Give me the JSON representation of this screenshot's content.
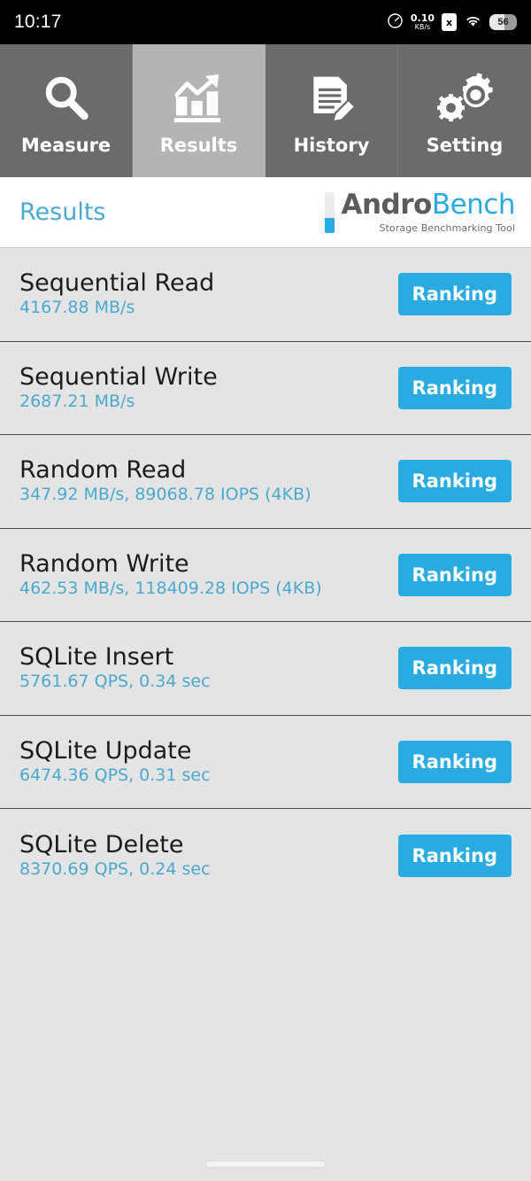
{
  "statusbar": {
    "time": "10:17",
    "network_speed_value": "0.10",
    "network_speed_unit": "KB/s",
    "speed_icon": "speedometer-icon",
    "sim_icon_label": "x",
    "wifi_icon": "wifi-icon",
    "battery_level": "56"
  },
  "tabs": [
    {
      "label": "Measure",
      "icon": "magnifier-icon",
      "active": false
    },
    {
      "label": "Results",
      "icon": "bar-chart-arrow-icon",
      "active": true
    },
    {
      "label": "History",
      "icon": "document-pencil-icon",
      "active": false
    },
    {
      "label": "Setting",
      "icon": "gears-icon",
      "active": false
    }
  ],
  "header": {
    "title": "Results",
    "logo_primary": "Andro",
    "logo_secondary": "Bench",
    "logo_tagline": "Storage Benchmarking Tool",
    "logo_bar_icon": "storage-level-bar-icon"
  },
  "results": [
    {
      "title": "Sequential Read",
      "value": "4167.88 MB/s",
      "button": "Ranking"
    },
    {
      "title": "Sequential Write",
      "value": "2687.21 MB/s",
      "button": "Ranking"
    },
    {
      "title": "Random Read",
      "value": "347.92 MB/s, 89068.78 IOPS (4KB)",
      "button": "Ranking"
    },
    {
      "title": "Random Write",
      "value": "462.53 MB/s, 118409.28 IOPS (4KB)",
      "button": "Ranking"
    },
    {
      "title": "SQLite Insert",
      "value": "5761.67 QPS, 0.34 sec",
      "button": "Ranking"
    },
    {
      "title": "SQLite Update",
      "value": "6474.36 QPS, 0.31 sec",
      "button": "Ranking"
    },
    {
      "title": "SQLite Delete",
      "value": "8370.69 QPS, 0.24 sec",
      "button": "Ranking"
    }
  ],
  "colors": {
    "accent_blue": "#29abe2",
    "value_blue": "#4aa9cf",
    "tab_inactive": "#6b6b6b",
    "tab_active": "#b4b4b4",
    "list_background": "#E4E4E4",
    "statusbar_background": "#000000"
  },
  "navigation": {
    "gesture_pill": "home-gesture-pill"
  }
}
